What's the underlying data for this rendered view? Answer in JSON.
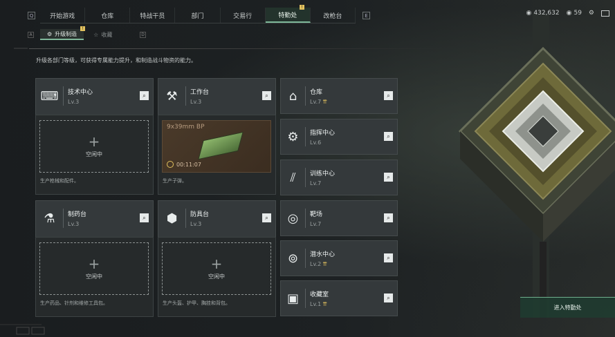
{
  "nav": {
    "tabs": [
      "开始游戏",
      "仓库",
      "特战干员",
      "部门",
      "交易行",
      "特勤处",
      "改枪台"
    ],
    "active_index": 5,
    "badge": "!",
    "left_arrow": "Q",
    "right_arrow": "E"
  },
  "top_right": {
    "currency": "432,632",
    "coins": "59"
  },
  "subnav": {
    "left_key": "A",
    "right_key": "D",
    "tabs": [
      "升级制造",
      "收藏"
    ],
    "badge": "!"
  },
  "description": "升级各部门等级，可获得专属能力提升，和制造战斗物资的能力。",
  "cards": [
    {
      "name": "技术中心",
      "level": "Lv.3",
      "status": "空闲中",
      "footer": "生产枪械和配件。"
    },
    {
      "name": "工作台",
      "level": "Lv.3",
      "product": "9x39mm BP",
      "timer": "00:11:07",
      "footer": "生产子弹。"
    },
    {
      "name": "制药台",
      "level": "Lv.3",
      "status": "空闲中",
      "footer": "生产药品、针剂和维修工具包。"
    },
    {
      "name": "防具台",
      "level": "Lv.3",
      "status": "空闲中",
      "footer": "生产头盔、护甲、胸挂和背包。"
    }
  ],
  "right_cards": [
    {
      "name": "仓库",
      "level": "Lv.7",
      "upgradable": true,
      "icon": "warehouse-icon"
    },
    {
      "name": "指挥中心",
      "level": "Lv.6",
      "upgradable": false,
      "icon": "chip-icon"
    },
    {
      "name": "训练中心",
      "level": "Lv.7",
      "upgradable": false,
      "icon": "dumbbell-icon"
    },
    {
      "name": "靶场",
      "level": "Lv.7",
      "upgradable": false,
      "icon": "target-icon"
    },
    {
      "name": "潜水中心",
      "level": "Lv.2",
      "upgradable": true,
      "icon": "diving-icon"
    },
    {
      "name": "收藏室",
      "level": "Lv.1",
      "upgradable": true,
      "icon": "collection-icon"
    }
  ],
  "enter_button": "进入特勤处",
  "colors": {
    "accent": "#7fb89a",
    "upgrade": "#e2c15e",
    "card": "#34393b"
  }
}
